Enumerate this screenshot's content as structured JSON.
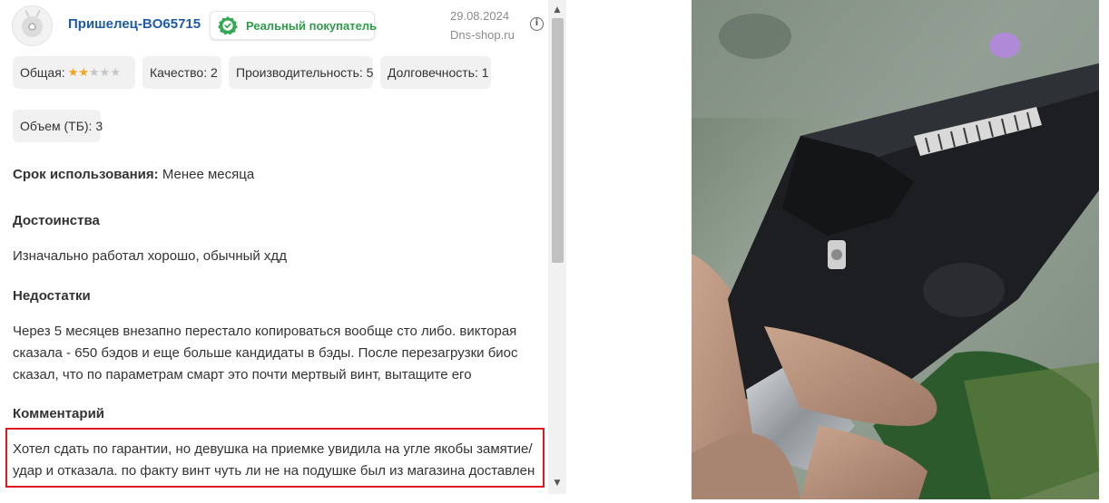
{
  "review": {
    "username": "Пришелец-BO65715",
    "badge": "Реальный покупатель",
    "date": "29.08.2024",
    "source": "Dns-shop.ru",
    "info_icon": "i",
    "ratings": {
      "overall_label": "Общая:",
      "overall_stars": 2,
      "overall_max": 5,
      "quality": "Качество: 2",
      "performance": "Производительность: 5",
      "durability": "Долговечность: 1",
      "volume": "Объем (ТБ): 3"
    },
    "usage_label": "Срок использования:",
    "usage_value": "Менее месяца",
    "advantages_title": "Достоинства",
    "advantages_text": "Изначально работал хорошо, обычный хдд",
    "disadvantages_title": "Недостатки",
    "disadvantages_text": "Через 5 месяцев внезапно перестало копироваться вообще сто либо. викторая сказала - 650 бэдов и еще больше кандидаты в бэды. После перезагрузки биос сказал, что по параметрам смарт это почти мертвый винт, вытащите его",
    "comment_title": "Комментарий",
    "comment_text": "Хотел сдать по гарантии, но девушка на приемке увидила на угле якобы замятие/удар и отказала. по факту винт чуть ли не на подушке был из магазина доставлен"
  },
  "colors": {
    "username": "#1e5aa8",
    "badge_text": "#2e9d4a",
    "star_filled": "#f7a21b",
    "star_empty": "#c6c6c6",
    "highlight_border": "#e0191e"
  },
  "icons": [
    "alien-avatar-icon",
    "verified-badge-icon",
    "info-icon",
    "star-icon",
    "scroll-up-arrow-icon",
    "scroll-down-arrow-icon"
  ]
}
